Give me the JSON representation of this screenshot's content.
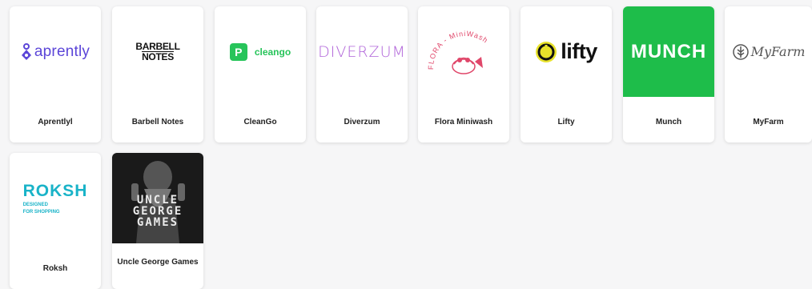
{
  "apps": [
    {
      "name": "Aprentlyl",
      "logo_text": "aprently",
      "brand_color": "#5b45d8",
      "icon": "aprently-logo-icon"
    },
    {
      "name": "Barbell Notes",
      "logo_line1": "BARBELL",
      "logo_line2": "NOTES",
      "brand_color": "#111111",
      "icon": "barbell-notes-logo-icon"
    },
    {
      "name": "CleanGo",
      "logo_text": "cleango",
      "logo_mark": "P",
      "brand_color": "#27c45a",
      "icon": "cleango-logo-icon"
    },
    {
      "name": "Diverzum",
      "logo_text": "DIVERZUM",
      "brand_color": "#b063d9",
      "icon": "diverzum-logo-icon"
    },
    {
      "name": "Flora Miniwash",
      "logo_text": "FLORA - MiniWash",
      "brand_color": "#e0476a",
      "icon": "flora-miniwash-logo-icon"
    },
    {
      "name": "Lifty",
      "logo_text": "lifty",
      "brand_color": "#111111",
      "accent_color": "#e8e22a",
      "icon": "lifty-logo-icon"
    },
    {
      "name": "Munch",
      "logo_text": "MUNCH",
      "brand_color": "#1ebd4a",
      "icon": "munch-logo-icon"
    },
    {
      "name": "MyFarm",
      "logo_text": "MyFarm",
      "brand_color": "#555555",
      "icon": "myfarm-logo-icon"
    },
    {
      "name": "Roksh",
      "logo_text": "ROKSH",
      "logo_sub1": "DESIGNED",
      "logo_sub2": "FOR SHOPPING",
      "brand_color": "#19b3c8",
      "icon": "roksh-logo-icon"
    },
    {
      "name": "Uncle George Games",
      "logo_text": "UNCLE GEORGE GAMES",
      "brand_color": "#1a1a1a",
      "icon": "uncle-george-games-logo-icon"
    }
  ]
}
